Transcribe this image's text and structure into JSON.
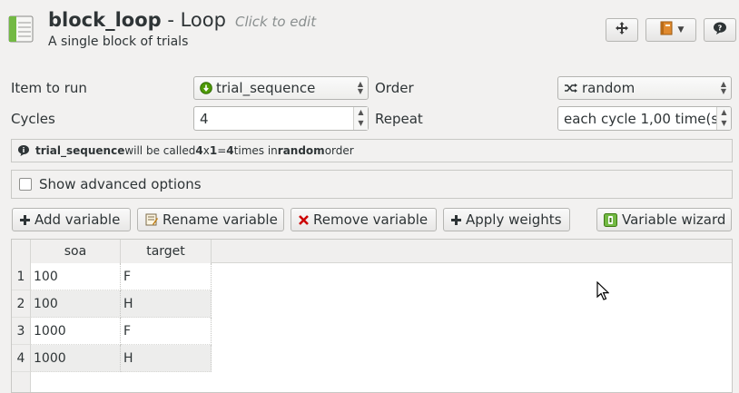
{
  "header": {
    "item_name": "block_loop",
    "item_type": " - Loop",
    "click_to_edit": "Click to edit",
    "description": "A single block of trials",
    "icons": {
      "app": "loop-item-icon",
      "move": "move-icon",
      "notebook": "notebook-icon",
      "help": "help-icon"
    }
  },
  "form": {
    "item_to_run_label": "Item to run",
    "item_to_run_value": "trial_sequence",
    "order_label": "Order",
    "order_value": "random",
    "cycles_label": "Cycles",
    "cycles_value": "4",
    "repeat_label": "Repeat",
    "repeat_value": "each cycle 1,00 time(s"
  },
  "summary": {
    "item": "trial_sequence",
    "will_be_called": " will be called ",
    "a": "4",
    "x": " x ",
    "b": "1",
    "eq": " = ",
    "total": "4",
    "times_in": " times in ",
    "order": "random",
    "order_suffix": " order"
  },
  "advanced": {
    "label": "Show advanced options",
    "checked": false
  },
  "toolbar": {
    "add_variable": "Add variable",
    "rename_variable": "Rename variable",
    "remove_variable": "Remove variable",
    "apply_weights": "Apply weights",
    "variable_wizard": "Variable wizard"
  },
  "table": {
    "columns": [
      "soa",
      "target"
    ],
    "rows": [
      {
        "index": "1",
        "soa": "100",
        "target": "F"
      },
      {
        "index": "2",
        "soa": "100",
        "target": "H"
      },
      {
        "index": "3",
        "soa": "1000",
        "target": "F"
      },
      {
        "index": "4",
        "soa": "1000",
        "target": "H"
      }
    ]
  },
  "colors": {
    "background": "#f2f1f0",
    "accent_green": "#4e9a06",
    "remove_red": "#cc0000",
    "alt_row": "#ededec"
  }
}
